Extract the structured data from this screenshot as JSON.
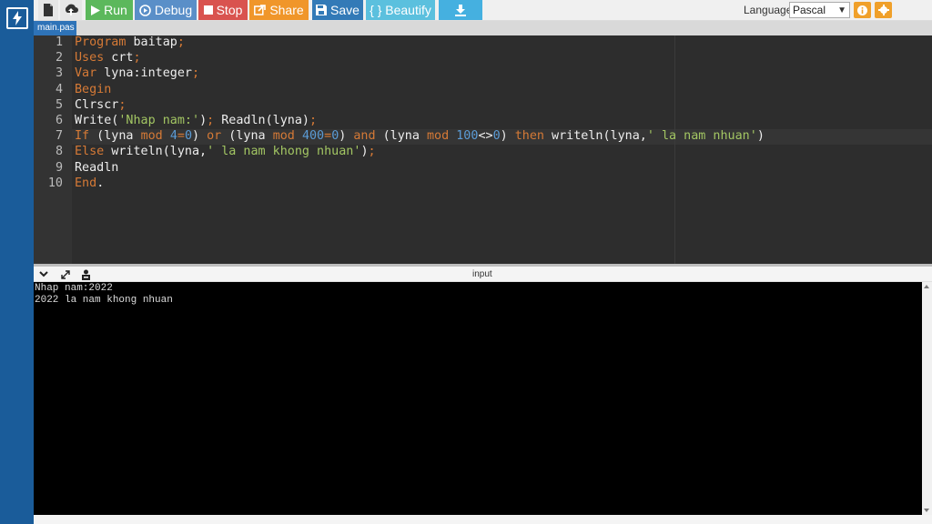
{
  "toolbar": {
    "run_label": "Run",
    "debug_label": "Debug",
    "stop_label": "Stop",
    "share_label": "Share",
    "save_label": "Save",
    "beautify_label": "{ } Beautify",
    "language_label": "Language",
    "language_value": "Pascal",
    "colors": {
      "run": "#5cb85c",
      "debug": "#5a8fc8",
      "stop": "#d9534f",
      "share": "#f0962a",
      "save": "#337ab7",
      "beautify": "#5bc0de",
      "download": "#45b0e0",
      "info_orange": "#f0a02a"
    },
    "icons": [
      "new-file-icon",
      "upload-icon",
      "play-icon",
      "debug-icon",
      "stop-icon",
      "share-icon",
      "save-icon",
      "download-icon",
      "info-icon",
      "gear-icon"
    ]
  },
  "file_tab": {
    "label": "main.pas"
  },
  "editor": {
    "line_numbers": [
      "1",
      "2",
      "3",
      "4",
      "5",
      "6",
      "7",
      "8",
      "9",
      "10"
    ],
    "lines": [
      [
        [
          "kw",
          "Program"
        ],
        [
          "plain",
          " baitap"
        ],
        [
          "kw",
          ";"
        ]
      ],
      [
        [
          "kw",
          "Uses"
        ],
        [
          "plain",
          " crt"
        ],
        [
          "kw",
          ";"
        ]
      ],
      [
        [
          "kw",
          "Var"
        ],
        [
          "plain",
          " lyna:integer"
        ],
        [
          "kw",
          ";"
        ]
      ],
      [
        [
          "kw",
          "Begin"
        ]
      ],
      [
        [
          "plain",
          "Clrscr"
        ],
        [
          "kw",
          ";"
        ]
      ],
      [
        [
          "plain",
          "Write("
        ],
        [
          "str",
          "'Nhap nam:'"
        ],
        [
          "plain",
          ")"
        ],
        [
          "kw",
          ";"
        ],
        [
          "plain",
          " Readln(lyna)"
        ],
        [
          "kw",
          ";"
        ]
      ],
      [
        [
          "kw",
          "If"
        ],
        [
          "plain",
          " (lyna "
        ],
        [
          "kw",
          "mod"
        ],
        [
          "plain",
          " "
        ],
        [
          "num",
          "4"
        ],
        [
          "kw",
          "="
        ],
        [
          "num",
          "0"
        ],
        [
          "plain",
          ") "
        ],
        [
          "kw",
          "or"
        ],
        [
          "plain",
          " (lyna "
        ],
        [
          "kw",
          "mod"
        ],
        [
          "plain",
          " "
        ],
        [
          "num",
          "400"
        ],
        [
          "kw",
          "="
        ],
        [
          "num",
          "0"
        ],
        [
          "plain",
          ") "
        ],
        [
          "kw",
          "and"
        ],
        [
          "plain",
          " (lyna "
        ],
        [
          "kw",
          "mod"
        ],
        [
          "plain",
          " "
        ],
        [
          "num",
          "100"
        ],
        [
          "plain",
          "<>"
        ],
        [
          "num",
          "0"
        ],
        [
          "plain",
          ") "
        ],
        [
          "kw",
          "then"
        ],
        [
          "plain",
          " writeln(lyna,"
        ],
        [
          "str",
          "' la nam nhuan'"
        ],
        [
          "plain",
          ")"
        ]
      ],
      [
        [
          "kw",
          "Else"
        ],
        [
          "plain",
          " writeln(lyna,"
        ],
        [
          "str",
          "' la nam khong nhuan'"
        ],
        [
          "plain",
          ")"
        ],
        [
          "kw",
          ";"
        ]
      ],
      [
        [
          "plain",
          "Readln"
        ]
      ],
      [
        [
          "kw",
          "End"
        ],
        [
          "plain",
          "."
        ]
      ]
    ]
  },
  "io_panel": {
    "label": "input",
    "icons": [
      "collapse-chevron-icon",
      "expand-arrows-icon",
      "terminal-user-icon"
    ],
    "output_lines": [
      "Nhap nam:2022",
      "2022 la nam khong nhuan"
    ]
  }
}
